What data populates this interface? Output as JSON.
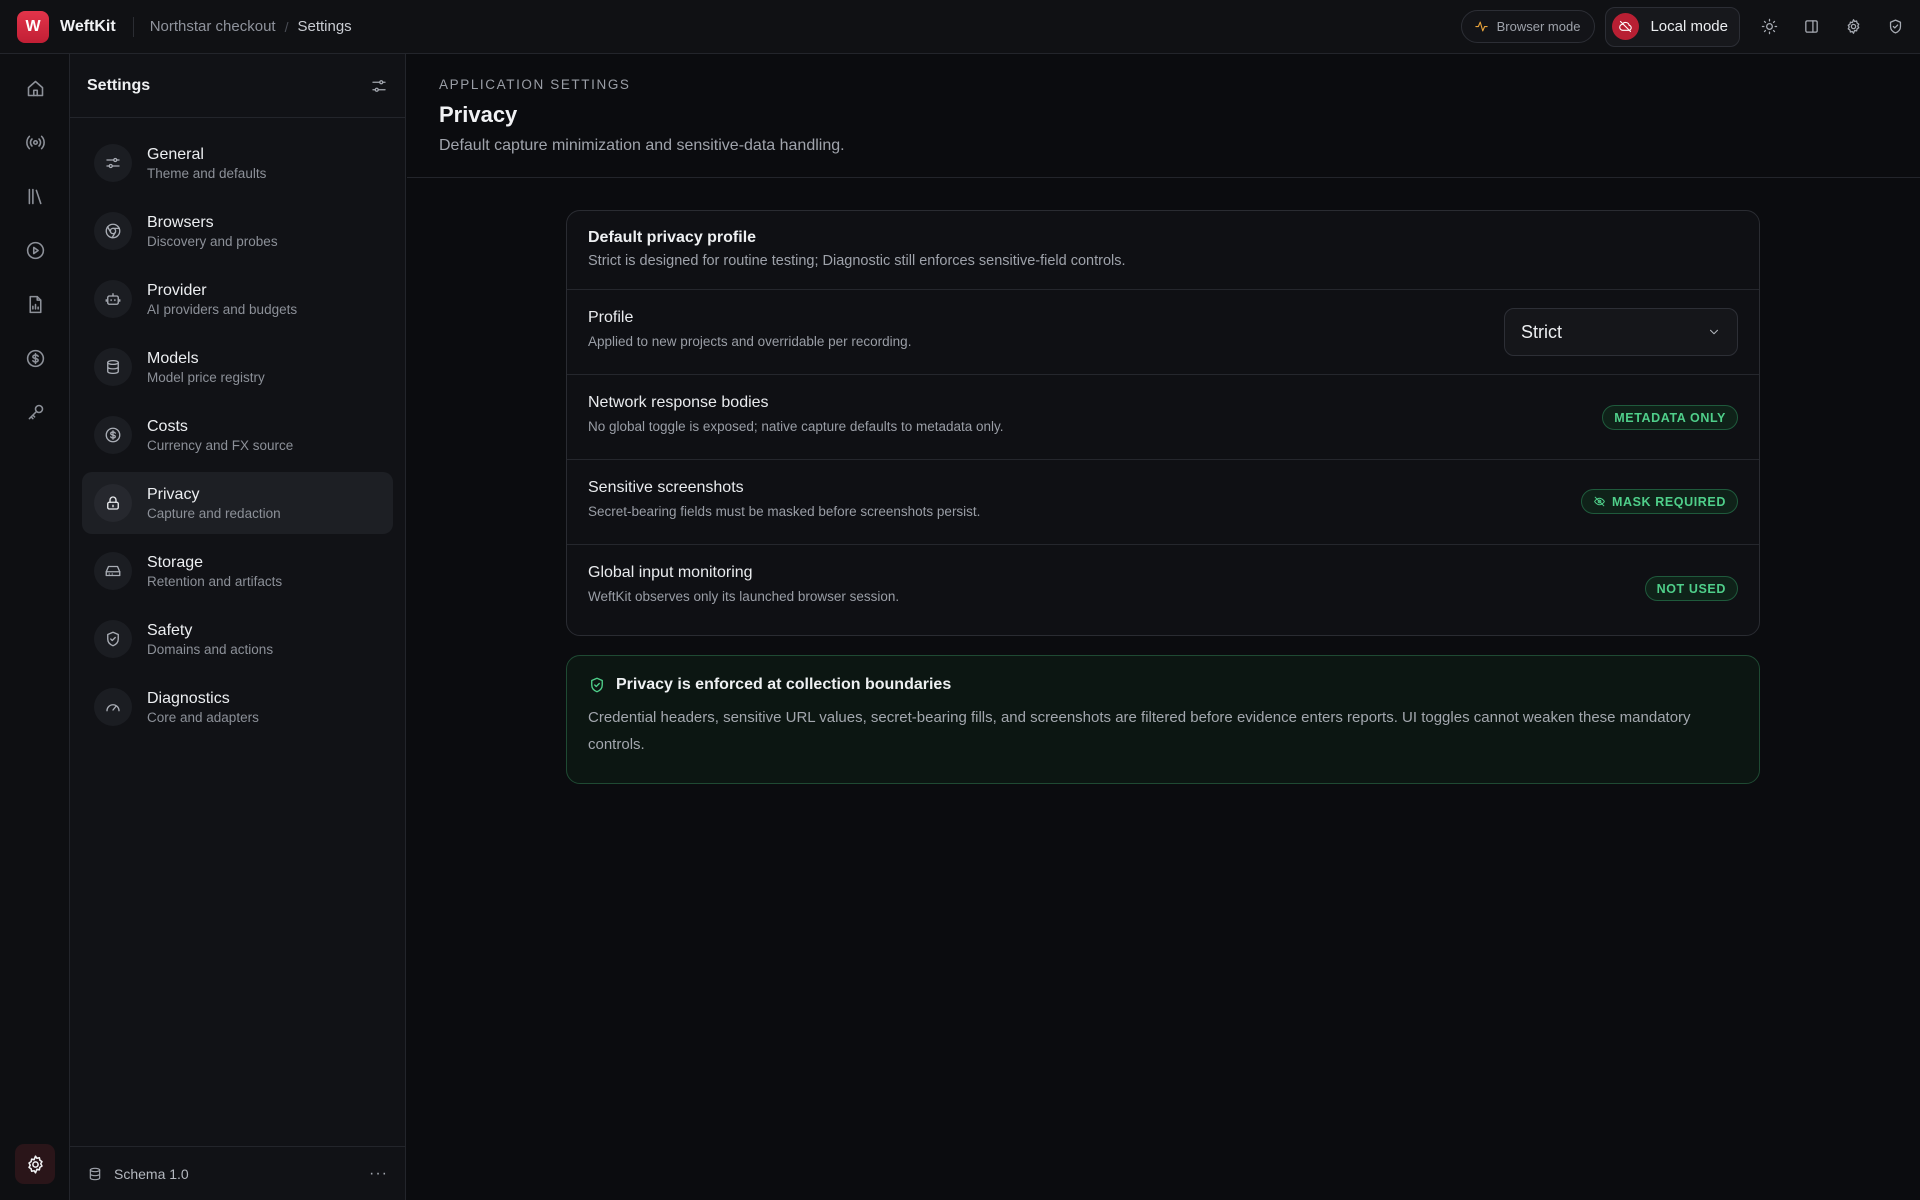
{
  "app": {
    "logo_letter": "W",
    "name": "WeftKit"
  },
  "breadcrumb": [
    "Northstar checkout",
    "Settings"
  ],
  "topbar": {
    "browser_mode": "Browser mode",
    "local_mode": "Local mode",
    "icons": [
      "sun-icon",
      "panel-icon",
      "gear-icon",
      "shield-icon"
    ]
  },
  "rail": {
    "icons": [
      "home-icon",
      "broadcast-icon",
      "library-icon",
      "play-icon",
      "report-icon",
      "dollar-icon",
      "key-icon"
    ],
    "bottom_icon": "gear-icon"
  },
  "sidebar": {
    "title": "Settings",
    "items": [
      {
        "label": "General",
        "sub": "Theme and defaults",
        "icon": "sliders-icon"
      },
      {
        "label": "Browsers",
        "sub": "Discovery and probes",
        "icon": "chrome-icon"
      },
      {
        "label": "Provider",
        "sub": "AI providers and budgets",
        "icon": "bot-icon"
      },
      {
        "label": "Models",
        "sub": "Model price registry",
        "icon": "database-icon"
      },
      {
        "label": "Costs",
        "sub": "Currency and FX source",
        "icon": "dollar-icon"
      },
      {
        "label": "Privacy",
        "sub": "Capture and redaction",
        "icon": "lock-icon",
        "active": true
      },
      {
        "label": "Storage",
        "sub": "Retention and artifacts",
        "icon": "drive-icon"
      },
      {
        "label": "Safety",
        "sub": "Domains and actions",
        "icon": "shield-check-icon"
      },
      {
        "label": "Diagnostics",
        "sub": "Core and adapters",
        "icon": "gauge-icon"
      }
    ],
    "footer": "Schema 1.0"
  },
  "page": {
    "eyebrow": "APPLICATION SETTINGS",
    "title": "Privacy",
    "subtitle": "Default capture minimization and sensitive-data handling."
  },
  "card": {
    "title": "Default privacy profile",
    "subtitle": "Strict is designed for routine testing; Diagnostic still enforces sensitive-field controls.",
    "rows": [
      {
        "label": "Profile",
        "sub": "Applied to new projects and overridable per recording.",
        "value": "Strict"
      },
      {
        "label": "Network response bodies",
        "sub": "No global toggle is exposed; native capture defaults to metadata only.",
        "badge": "METADATA ONLY"
      },
      {
        "label": "Sensitive screenshots",
        "sub": "Secret-bearing fields must be masked before screenshots persist.",
        "badge": "MASK REQUIRED"
      },
      {
        "label": "Global input monitoring",
        "sub": "WeftKit observes only its launched browser session.",
        "badge": "NOT USED"
      }
    ]
  },
  "notice": {
    "title": "Privacy is enforced at collection boundaries",
    "body": "Credential headers, sensitive URL values, secret-bearing fills, and screenshots are filtered before evidence enters reports. UI toggles cannot weaken these mandatory controls."
  },
  "colors": {
    "accent": "#d42a40",
    "success": "#4fcf8a",
    "background": "#0b0c0f"
  }
}
